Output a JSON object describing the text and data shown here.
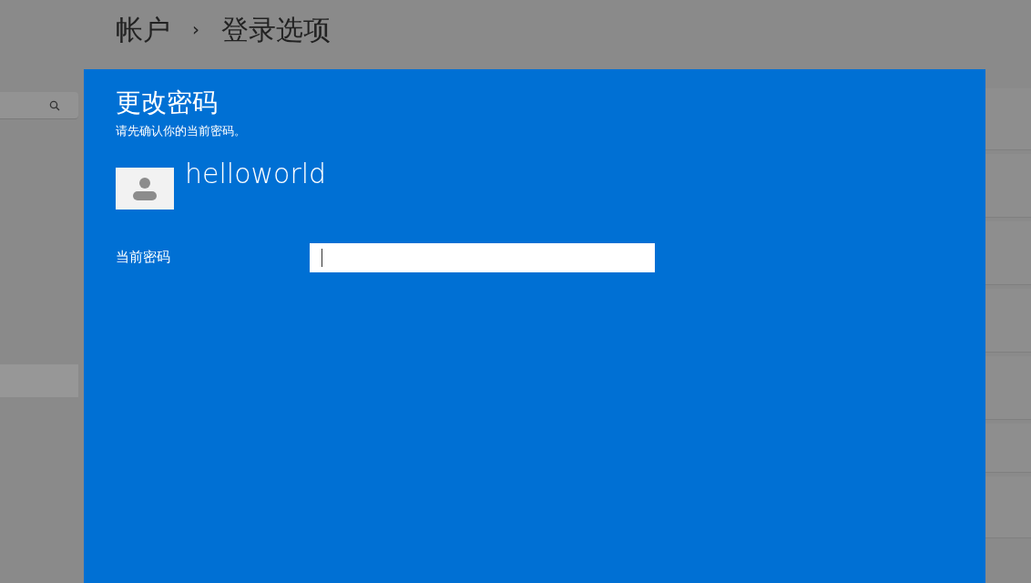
{
  "breadcrumb": {
    "parent": "帐户",
    "separator": "›",
    "current": "登录选项"
  },
  "dialog": {
    "title": "更改密码",
    "subtitle": "请先确认你的当前密码。",
    "user": {
      "name": "helloworld"
    },
    "fields": [
      {
        "label": "当前密码",
        "focused": true
      }
    ]
  }
}
